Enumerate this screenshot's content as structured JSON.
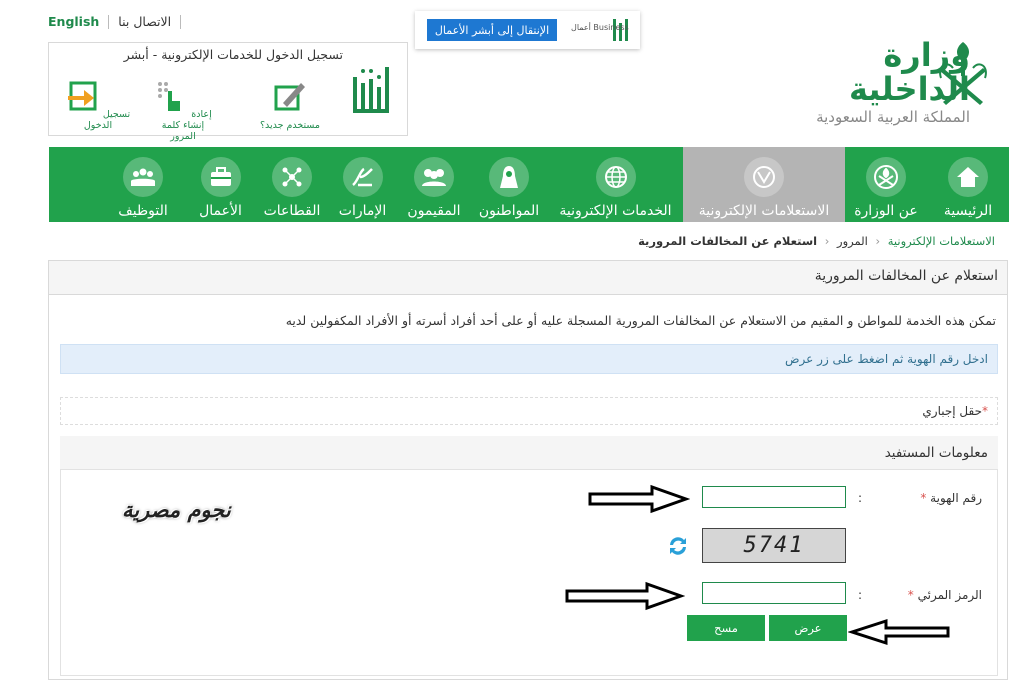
{
  "top_links": {
    "english": "English",
    "contact": "الاتصال بنا"
  },
  "login_box": {
    "title": "تسجيل الدخول للخدمات الإلكترونية - أبشر",
    "actions": [
      "مستخدم جديد؟",
      "إعادة إنشاء كلمة المرور",
      "تسجيل الدخول"
    ]
  },
  "business_banner": {
    "button": "الإنتقال إلى أبشر الأعمال",
    "logo_text": "أعمال Business"
  },
  "ministry": {
    "name": "وزارة الداخلية",
    "country": "المملكة العربية السعودية"
  },
  "nav": [
    {
      "label": "الرئيسية",
      "icon": "home-icon"
    },
    {
      "label": "عن الوزارة",
      "icon": "emblem-icon"
    },
    {
      "label": "الاستعلامات الإلكترونية",
      "icon": "inquiry-icon",
      "active": true
    },
    {
      "label": "الخدمات الإلكترونية",
      "icon": "globe-icon"
    },
    {
      "label": "المواطنون",
      "icon": "citizen-icon"
    },
    {
      "label": "المقيمون",
      "icon": "residents-icon"
    },
    {
      "label": "الإمارات",
      "icon": "emirates-icon"
    },
    {
      "label": "القطاعات",
      "icon": "sectors-icon"
    },
    {
      "label": "الأعمال",
      "icon": "briefcase-icon"
    },
    {
      "label": "التوظيف",
      "icon": "employment-icon"
    }
  ],
  "breadcrumb": [
    "الاستعلامات الإلكترونية",
    "المرور",
    "استعلام عن المخالفات المرورية"
  ],
  "panel": {
    "title": "استعلام عن المخالفات المرورية",
    "description": "تمكن هذه الخدمة للمواطن و المقيم من الاستعلام عن المخالفات المرورية المسجلة عليه أو على أحد أفراد أسرته أو الأفراد المكفولين لديه",
    "info": "ادخل رقم الهوية ثم اضغط على زر عرض",
    "required_note": "حقل إجباري"
  },
  "beneficiary": {
    "title": "معلومات المستفيد",
    "id_label": "رقم الهوية",
    "captcha_label": "الرمز المرئي",
    "colon": ":",
    "id_value": "",
    "captcha_value": "",
    "captcha_text": "5741",
    "show_button": "عرض",
    "clear_button": "مسح"
  },
  "watermark": "نجوم مصرية",
  "colors": {
    "brand_green": "#21a24c",
    "active_tab": "#b4b4b4",
    "info_bg": "#e3eefa"
  }
}
